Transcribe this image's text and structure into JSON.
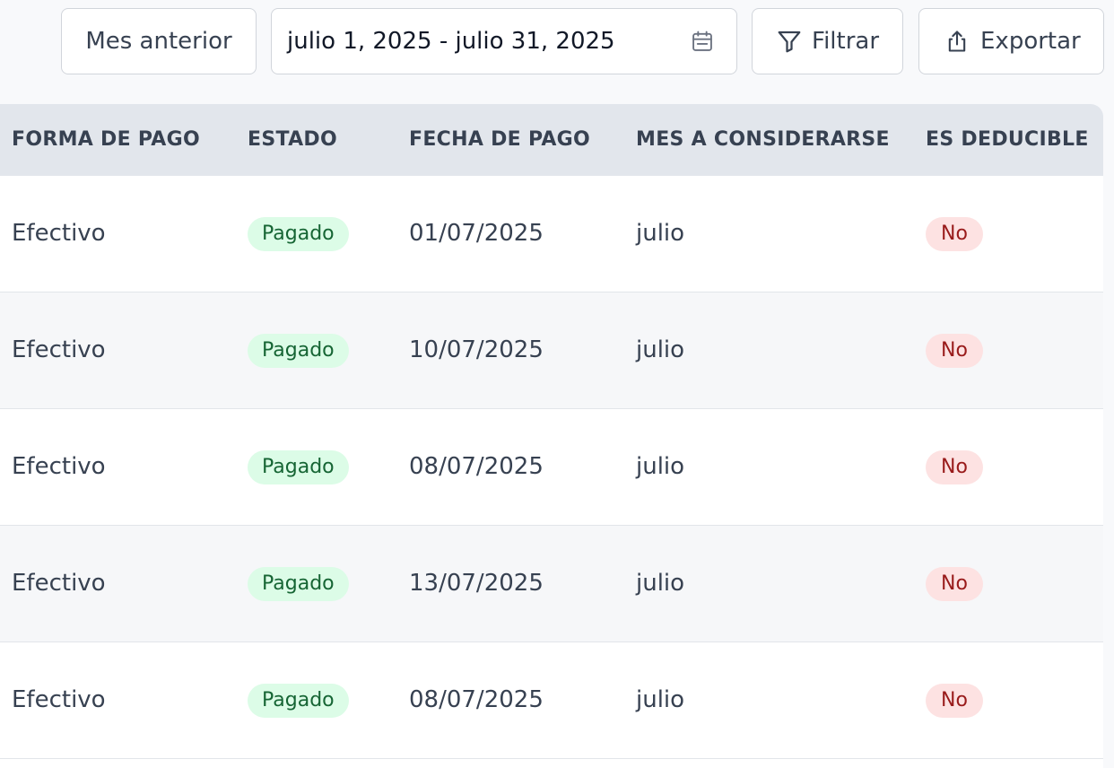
{
  "toolbar": {
    "prev_month_label": "Mes anterior",
    "date_range": "julio 1, 2025 - julio 31, 2025",
    "filter_label": "Filtrar",
    "export_label": "Exportar"
  },
  "table": {
    "columns": [
      "FORMA DE PAGO",
      "ESTADO",
      "FECHA DE PAGO",
      "MES A CONSIDERARSE",
      "ES DEDUCIBLE"
    ],
    "rows": [
      {
        "forma_pago": "Efectivo",
        "estado": "Pagado",
        "fecha_pago": "01/07/2025",
        "mes": "julio",
        "deducible": "No"
      },
      {
        "forma_pago": "Efectivo",
        "estado": "Pagado",
        "fecha_pago": "10/07/2025",
        "mes": "julio",
        "deducible": "No"
      },
      {
        "forma_pago": "Efectivo",
        "estado": "Pagado",
        "fecha_pago": "08/07/2025",
        "mes": "julio",
        "deducible": "No"
      },
      {
        "forma_pago": "Efectivo",
        "estado": "Pagado",
        "fecha_pago": "13/07/2025",
        "mes": "julio",
        "deducible": "No"
      },
      {
        "forma_pago": "Efectivo",
        "estado": "Pagado",
        "fecha_pago": "08/07/2025",
        "mes": "julio",
        "deducible": "No"
      }
    ]
  },
  "colors": {
    "status_paid_bg": "#dcfce7",
    "status_paid_text": "#166534",
    "deductible_no_bg": "#fde2e2",
    "deductible_no_text": "#991b1b",
    "header_bg": "#e2e6ec"
  },
  "icons": {
    "date_range": "calendar-icon",
    "filter": "filter-icon",
    "export": "export-share-icon"
  }
}
